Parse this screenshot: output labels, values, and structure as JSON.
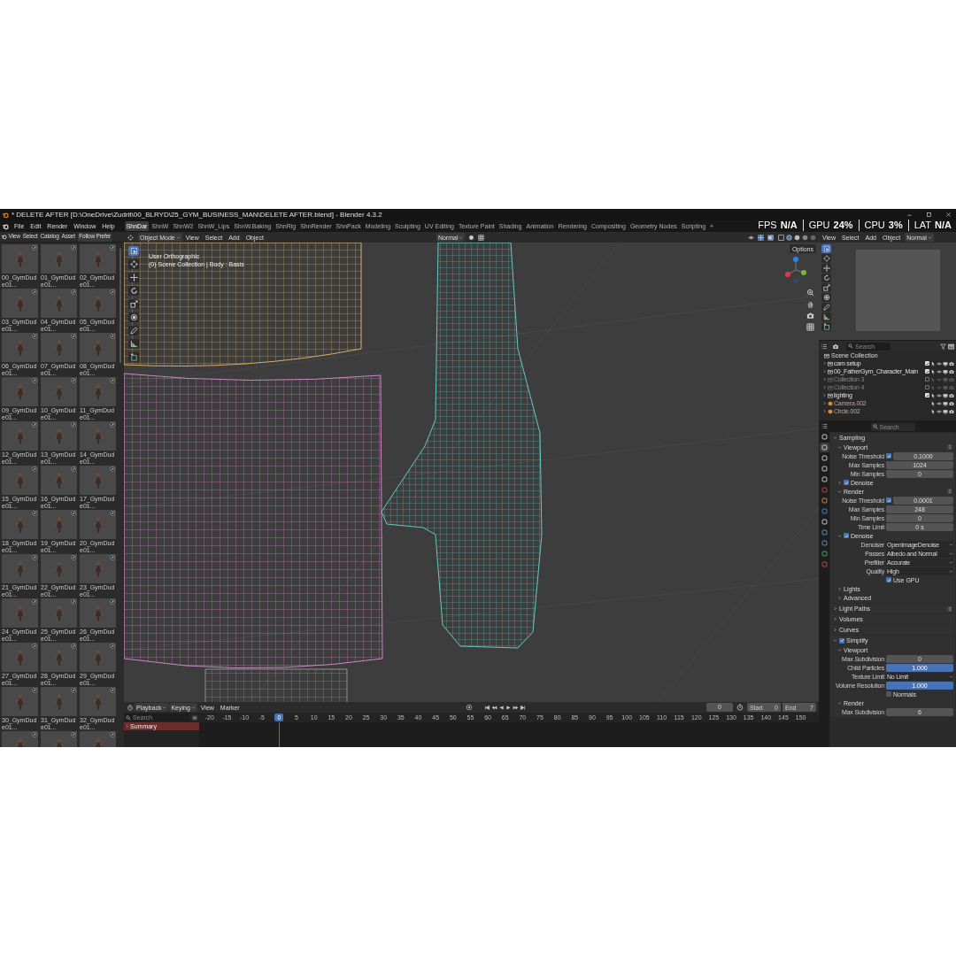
{
  "window": {
    "title": "* DELETE AFTER [D:\\OneDrive\\Zudrit\\00_BLRYD\\25_GYM_BUSINESS_MAN\\DELETE AFTER.blend] - Blender 4.3.2"
  },
  "stats_overlay": [
    {
      "label": "FPS",
      "value": "N/A"
    },
    {
      "label": "GPU",
      "value": "24%"
    },
    {
      "label": "CPU",
      "value": "3%"
    },
    {
      "label": "LAT",
      "value": "N/A"
    }
  ],
  "menu": [
    "File",
    "Edit",
    "Render",
    "Window",
    "Help"
  ],
  "workspaces": [
    {
      "label": "ShnDar",
      "selected": true
    },
    {
      "label": "ShnW",
      "selected": false
    },
    {
      "label": "ShnW2",
      "selected": false
    },
    {
      "label": "ShnW_Lips",
      "selected": false
    },
    {
      "label": "ShnW.Baking",
      "selected": false
    },
    {
      "label": "ShnRig",
      "selected": false
    },
    {
      "label": "ShnRender",
      "selected": false
    },
    {
      "label": "ShnPack",
      "selected": false
    },
    {
      "label": "Modeling",
      "selected": false
    },
    {
      "label": "Sculpting",
      "selected": false
    },
    {
      "label": "UV Editing",
      "selected": false
    },
    {
      "label": "Texture Paint",
      "selected": false
    },
    {
      "label": "Shading",
      "selected": false
    },
    {
      "label": "Animation",
      "selected": false
    },
    {
      "label": "Rendering",
      "selected": false
    },
    {
      "label": "Compositing",
      "selected": false
    },
    {
      "label": "Geometry Nodes",
      "selected": false
    },
    {
      "label": "Scripting",
      "selected": false
    },
    {
      "label": "+",
      "selected": false
    }
  ],
  "asset_browser": {
    "menus": [
      "View",
      "Select",
      "Catalog",
      "Asset"
    ],
    "library": "Follow Prefer",
    "assets": [
      {
        "label": "00_GymDude01..."
      },
      {
        "label": "01_GymDude01..."
      },
      {
        "label": "02_GymDude01..."
      },
      {
        "label": "03_GymDude01..."
      },
      {
        "label": "04_GymDude01..."
      },
      {
        "label": "05_GymDude01..."
      },
      {
        "label": "06_GymDude01..."
      },
      {
        "label": "07_GymDude01..."
      },
      {
        "label": "08_GymDude01..."
      },
      {
        "label": "09_GymDude01..."
      },
      {
        "label": "10_GymDude01..."
      },
      {
        "label": "11_GymDude01..."
      },
      {
        "label": "12_GymDude01..."
      },
      {
        "label": "13_GymDude01..."
      },
      {
        "label": "14_GymDude01..."
      },
      {
        "label": "15_GymDude01..."
      },
      {
        "label": "16_GymDude01..."
      },
      {
        "label": "17_GymDude01..."
      },
      {
        "label": "18_GymDude01..."
      },
      {
        "label": "19_GymDude01..."
      },
      {
        "label": "20_GymDude01..."
      },
      {
        "label": "21_GymDude01..."
      },
      {
        "label": "22_GymDude01..."
      },
      {
        "label": "23_GymDude01..."
      },
      {
        "label": "24_GymDude01..."
      },
      {
        "label": "25_GymDude01..."
      },
      {
        "label": "26_GymDude01..."
      },
      {
        "label": "27_GymDude01..."
      },
      {
        "label": "28_GymDude01..."
      },
      {
        "label": "29_GymDude01..."
      },
      {
        "label": "30_GymDude01..."
      },
      {
        "label": "31_GymDude01..."
      },
      {
        "label": "32_GymDude01..."
      },
      {
        "kind": "unlabeled"
      },
      {
        "kind": "unlabeled"
      },
      {
        "kind": "unlabeled"
      }
    ]
  },
  "viewport": {
    "mode": "Object Mode",
    "menus": [
      "View",
      "Select",
      "Add",
      "Object"
    ],
    "orientation": "Normal",
    "options": "Options",
    "view_name": "User Orthographic",
    "context": "(0) Scene Collection | Body : Basis",
    "tools": [
      {
        "selected": true
      },
      {
        "selected": false
      },
      {
        "selected": false
      },
      {
        "selected": false
      },
      {
        "selected": false
      },
      {
        "selected": false
      },
      {
        "selected": false
      },
      {
        "selected": false
      },
      {
        "selected": false
      }
    ]
  },
  "preview": {
    "menus": [
      "View",
      "Select",
      "Add",
      "Object"
    ],
    "orientation": "Normal",
    "tools": [
      {
        "selected": true
      },
      {
        "selected": false
      },
      {
        "selected": false
      },
      {
        "selected": false
      },
      {
        "selected": false
      },
      {
        "selected": false
      },
      {
        "selected": false
      },
      {
        "selected": false
      },
      {
        "selected": false
      }
    ]
  },
  "outliner": {
    "search_placeholder": "Search",
    "root": "Scene Collection",
    "items": [
      {
        "kind": "collection",
        "label": "cam setup",
        "checked": true
      },
      {
        "kind": "collection",
        "label": "00_FatherGym_Character_Main",
        "checked": true
      },
      {
        "kind": "collection",
        "label": "Collection 3",
        "checked": false
      },
      {
        "kind": "collection",
        "label": "Collection 4",
        "checked": false
      },
      {
        "kind": "collection",
        "label": "lighting",
        "checked": true
      },
      {
        "kind": "object",
        "label": "Camera.002"
      },
      {
        "kind": "object",
        "label": "Circle.002"
      }
    ]
  },
  "properties": {
    "search_placeholder": "Search",
    "tabs": [
      {
        "selected": false
      },
      {
        "selected": true
      },
      {
        "selected": false
      },
      {
        "selected": false
      },
      {
        "selected": false
      },
      {
        "selected": false
      },
      {
        "selected": false
      },
      {
        "selected": false
      },
      {
        "selected": false
      },
      {
        "selected": false
      },
      {
        "selected": false
      },
      {
        "selected": false
      },
      {
        "selected": false
      }
    ],
    "panels": [
      {
        "label": "Sampling",
        "expanded": true,
        "children": [
          {
            "label": "Viewport",
            "expanded": true,
            "list_icon": true,
            "fields": [
              {
                "kind": "check_number",
                "label": "Noise Threshold",
                "checked": true,
                "value": "0.1000"
              },
              {
                "kind": "number",
                "label": "Max Samples",
                "value": "1024"
              },
              {
                "kind": "number",
                "label": "Min Samples",
                "value": "0"
              }
            ]
          },
          {
            "label": "Denoise",
            "expanded": false,
            "checked": true
          },
          {
            "label": "Render",
            "expanded": true,
            "list_icon": true,
            "fields": [
              {
                "kind": "check_number",
                "label": "Noise Threshold",
                "checked": true,
                "value": "0.0001"
              },
              {
                "kind": "number",
                "label": "Max Samples",
                "value": "248"
              },
              {
                "kind": "number",
                "label": "Min Samples",
                "value": "0"
              },
              {
                "kind": "number",
                "label": "Time Limit",
                "value": "0 s"
              }
            ]
          },
          {
            "label": "Denoise",
            "expanded": true,
            "checked": true,
            "fields": [
              {
                "kind": "dropdown",
                "label": "Denoiser",
                "value": "OpenImageDenoise"
              },
              {
                "kind": "dropdown",
                "label": "Passes",
                "value": "Albedo and Normal"
              },
              {
                "kind": "dropdown",
                "label": "Prefilter",
                "value": "Accurate"
              },
              {
                "kind": "dropdown",
                "label": "Quality",
                "value": "High"
              },
              {
                "kind": "checkbox",
                "label": "Use GPU",
                "checked": true
              }
            ]
          },
          {
            "label": "Lights",
            "expanded": false
          },
          {
            "label": "Advanced",
            "expanded": false
          }
        ]
      },
      {
        "label": "Light Paths",
        "expanded": false,
        "list_icon": true
      },
      {
        "label": "Volumes",
        "expanded": false
      },
      {
        "label": "Curves",
        "expanded": false
      },
      {
        "label": "Simplify",
        "expanded": true,
        "checked": true,
        "children": [
          {
            "label": "Viewport",
            "expanded": true,
            "fields": [
              {
                "kind": "number",
                "label": "Max Subdivision",
                "value": "0"
              },
              {
                "kind": "slider",
                "label": "Child Particles",
                "value": "1.000",
                "level": 1
              },
              {
                "kind": "dropdown",
                "label": "Texture Limit",
                "value": "No Limit"
              },
              {
                "kind": "slider",
                "label": "Volume Resolution",
                "value": "1.000",
                "level": 1
              },
              {
                "kind": "checkbox",
                "label": "Normals",
                "checked": false
              }
            ]
          },
          {
            "label": "Render",
            "expanded": true,
            "fields": [
              {
                "kind": "number",
                "label": "Max Subdivision",
                "value": "6"
              }
            ]
          }
        ]
      }
    ]
  },
  "timeline": {
    "menus": [
      "Playback",
      "Keying",
      "View",
      "Marker"
    ],
    "current_frame": "0",
    "start_label": "Start",
    "start": "0",
    "end_label": "End",
    "end": "7",
    "search_placeholder": "Search",
    "channel": "Summary",
    "ticks": [
      {
        "label": "-20",
        "selected": false
      },
      {
        "label": "-15",
        "selected": false
      },
      {
        "label": "-10",
        "selected": false
      },
      {
        "label": "-5",
        "selected": false
      },
      {
        "label": "0",
        "selected": true
      },
      {
        "label": "5",
        "selected": false
      },
      {
        "label": "10",
        "selected": false
      },
      {
        "label": "15",
        "selected": false
      },
      {
        "label": "20",
        "selected": false
      },
      {
        "label": "25",
        "selected": false
      },
      {
        "label": "30",
        "selected": false
      },
      {
        "label": "35",
        "selected": false
      },
      {
        "label": "40",
        "selected": false
      },
      {
        "label": "45",
        "selected": false
      },
      {
        "label": "50",
        "selected": false
      },
      {
        "label": "55",
        "selected": false
      },
      {
        "label": "60",
        "selected": false
      },
      {
        "label": "65",
        "selected": false
      },
      {
        "label": "70",
        "selected": false
      },
      {
        "label": "75",
        "selected": false
      },
      {
        "label": "80",
        "selected": false
      },
      {
        "label": "85",
        "selected": false
      },
      {
        "label": "90",
        "selected": false
      },
      {
        "label": "95",
        "selected": false
      },
      {
        "label": "100",
        "selected": false
      },
      {
        "label": "105",
        "selected": false
      },
      {
        "label": "110",
        "selected": false
      },
      {
        "label": "115",
        "selected": false
      },
      {
        "label": "120",
        "selected": false
      },
      {
        "label": "125",
        "selected": false
      },
      {
        "label": "130",
        "selected": false
      },
      {
        "label": "135",
        "selected": false
      },
      {
        "label": "140",
        "selected": false
      },
      {
        "label": "145",
        "selected": false
      },
      {
        "label": "150",
        "selected": false
      }
    ]
  }
}
